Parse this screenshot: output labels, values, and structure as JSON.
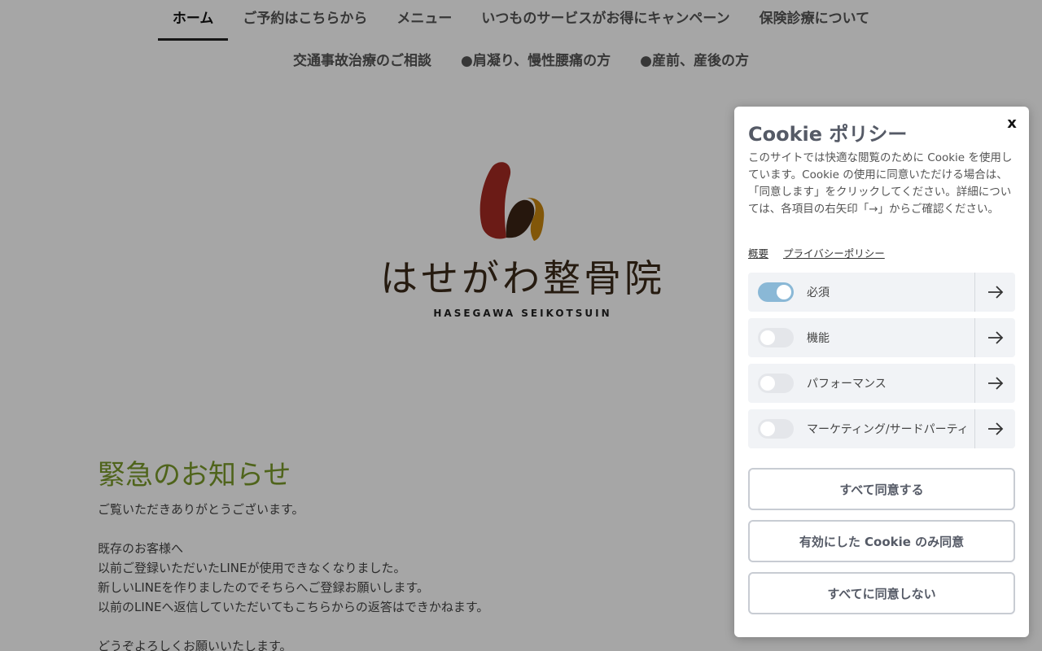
{
  "nav": {
    "row1": [
      "ホーム",
      "ご予約はこちらから",
      "メニュー",
      "いつものサービスがお得にキャンペーン",
      "保険診療について"
    ],
    "row2": [
      "交通事故治療のご相談",
      "●肩凝り、慢性腰痛の方",
      "●産前、産後の方"
    ]
  },
  "logo": {
    "text": "はせがわ整骨院",
    "subtitle": "HASEGAWA SEIKOTSUIN",
    "colors": {
      "red": "#a52a22",
      "dark": "#3b2414",
      "orange": "#c8860f"
    }
  },
  "notice": {
    "title": "緊急のお知らせ",
    "lines": [
      "ご覧いただきありがとうございます。",
      "",
      "既存のお客様へ",
      "以前ご登録いただいたLINEが使用できなくなりました。",
      "新しいLINEを作りましたのでそちらへご登録お願いします。",
      "以前のLINEへ返信していただいてもこちらからの返答はできかねます。",
      "",
      "どうぞよろしくお願いいたします。"
    ]
  },
  "cookie": {
    "close_label": "x",
    "title": "Cookie ポリシー",
    "description": "このサイトでは快適な閲覧のために Cookie を使用しています。Cookie の使用に同意いただける場合は、「同意します」をクリックしてください。詳細については、各項目の右矢印「→」からご確認ください。",
    "links": [
      "概要",
      "プライバシーポリシー"
    ],
    "categories": [
      {
        "label": "必須",
        "enabled": true
      },
      {
        "label": "機能",
        "enabled": false
      },
      {
        "label": "パフォーマンス",
        "enabled": false
      },
      {
        "label": "マーケティング/サードパーティ",
        "enabled": false
      }
    ],
    "buttons": {
      "accept_all": "すべて同意する",
      "accept_selected": "有効にした Cookie のみ同意",
      "reject_all": "すべてに同意しない"
    },
    "toggle_on_color": "#8ab8d6"
  }
}
